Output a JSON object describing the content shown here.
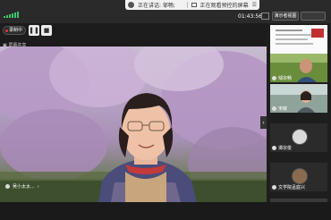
{
  "topbar": {
    "speaking_text": "正在讲话: 邹畅;",
    "notice_text": "正在观看预控的屏幕",
    "timer": "01:43:56",
    "layout_button": "演示者视图"
  },
  "controls": {
    "rec_label": "录制中",
    "pause_icon": "pause-icon",
    "stop_icon": "stop-icon",
    "share_label": "屏幕共享"
  },
  "main_video": {
    "name_label": "吴小太太..."
  },
  "participants": [
    {
      "name": "邹宗畅"
    },
    {
      "name": "宋敏"
    },
    {
      "name": "谭宗俊"
    },
    {
      "name": "文学院孟庭兴"
    }
  ],
  "colors": {
    "accent_green": "#3ec46d",
    "record_red": "#e33333"
  }
}
